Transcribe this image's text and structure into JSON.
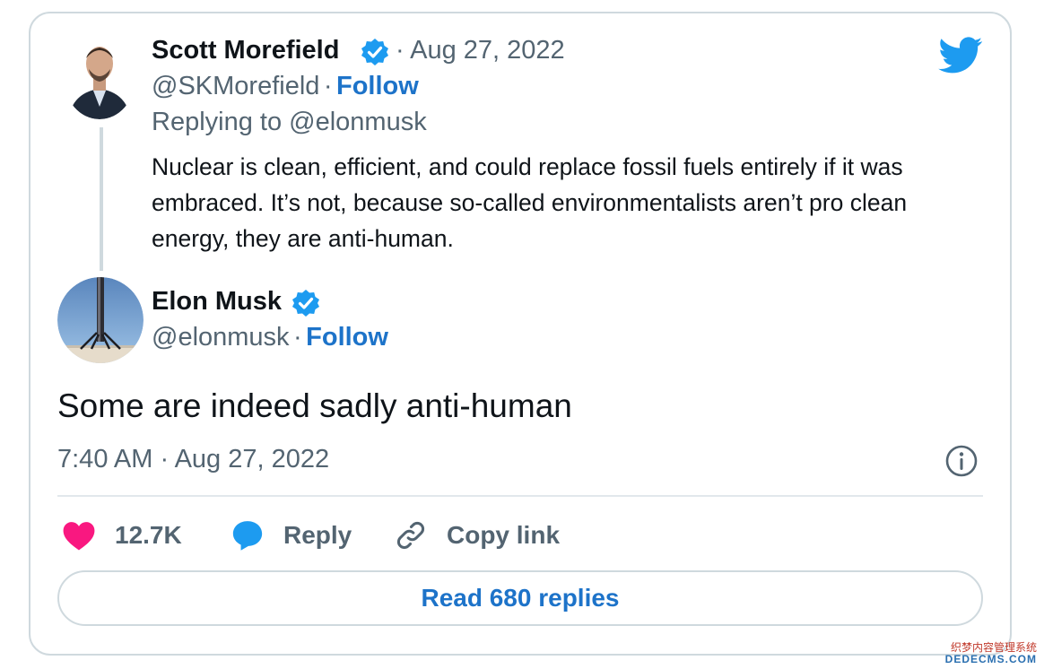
{
  "reply_to_tweet": {
    "author_name": "Scott Morefield",
    "date": "· Aug 27, 2022",
    "handle": "@SKMorefield",
    "separator": "·",
    "follow_label": "Follow",
    "replying_to": "Replying to @elonmusk",
    "text": "Nuclear is clean, efficient, and could replace fossil fuels entirely if it was embraced. It’s not, because so-called environmentalists aren’t pro clean energy, they are anti-human."
  },
  "main_tweet": {
    "author_name": "Elon Musk",
    "handle": "@elonmusk",
    "separator": "·",
    "follow_label": "Follow",
    "text": "Some are indeed sadly anti-human",
    "timestamp": "7:40 AM · Aug 27, 2022"
  },
  "actions": {
    "like_count": "12.7K",
    "reply_label": "Reply",
    "copy_link_label": "Copy link"
  },
  "read_replies_label": "Read 680 replies",
  "watermark": {
    "line1": "织梦内容管理系统",
    "line2": "DEDECMS.COM"
  },
  "colors": {
    "accent": "#1d9bf0",
    "link": "#1d73c9",
    "like": "#f91880",
    "muted": "#536471",
    "border": "#cfd9de"
  },
  "icons": [
    "twitter-bird-icon",
    "verified-badge-icon",
    "info-icon",
    "heart-icon",
    "reply-bubble-icon",
    "link-icon"
  ]
}
